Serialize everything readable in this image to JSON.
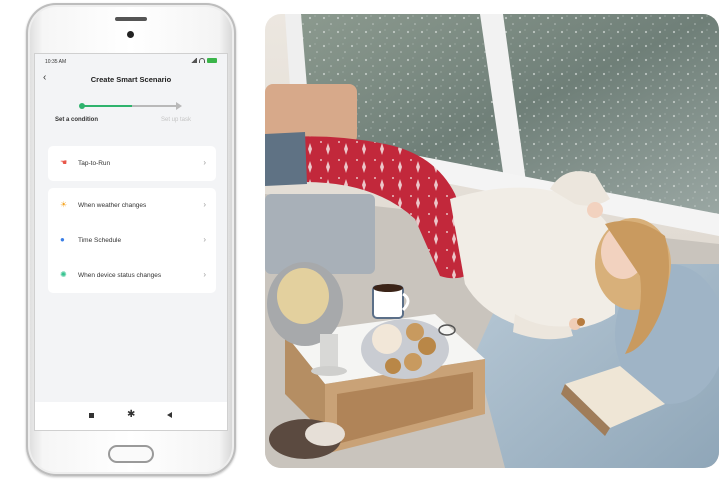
{
  "status_bar": {
    "time": "10:35 AM"
  },
  "header": {
    "back_glyph": "‹",
    "title": "Create Smart Scenario"
  },
  "steps": {
    "step1": "Set a condition",
    "step2": "Set up task"
  },
  "conditions": {
    "tap": {
      "label": "Tap-to-Run",
      "icon": "hand-tap-icon"
    },
    "weather": {
      "label": "When weather changes",
      "icon": "sun-icon"
    },
    "schedule": {
      "label": "Time Schedule",
      "icon": "clock-icon"
    },
    "device": {
      "label": "When device status changes",
      "icon": "device-icon"
    }
  },
  "chevron": "›",
  "colors": {
    "accent": "#2fb36d",
    "tap_icon": "#e8574a",
    "weather_icon": "#f5a524",
    "schedule_icon": "#3a7ee6",
    "device_icon": "#34c38f"
  },
  "nav": {
    "home_glyph": "✱"
  }
}
